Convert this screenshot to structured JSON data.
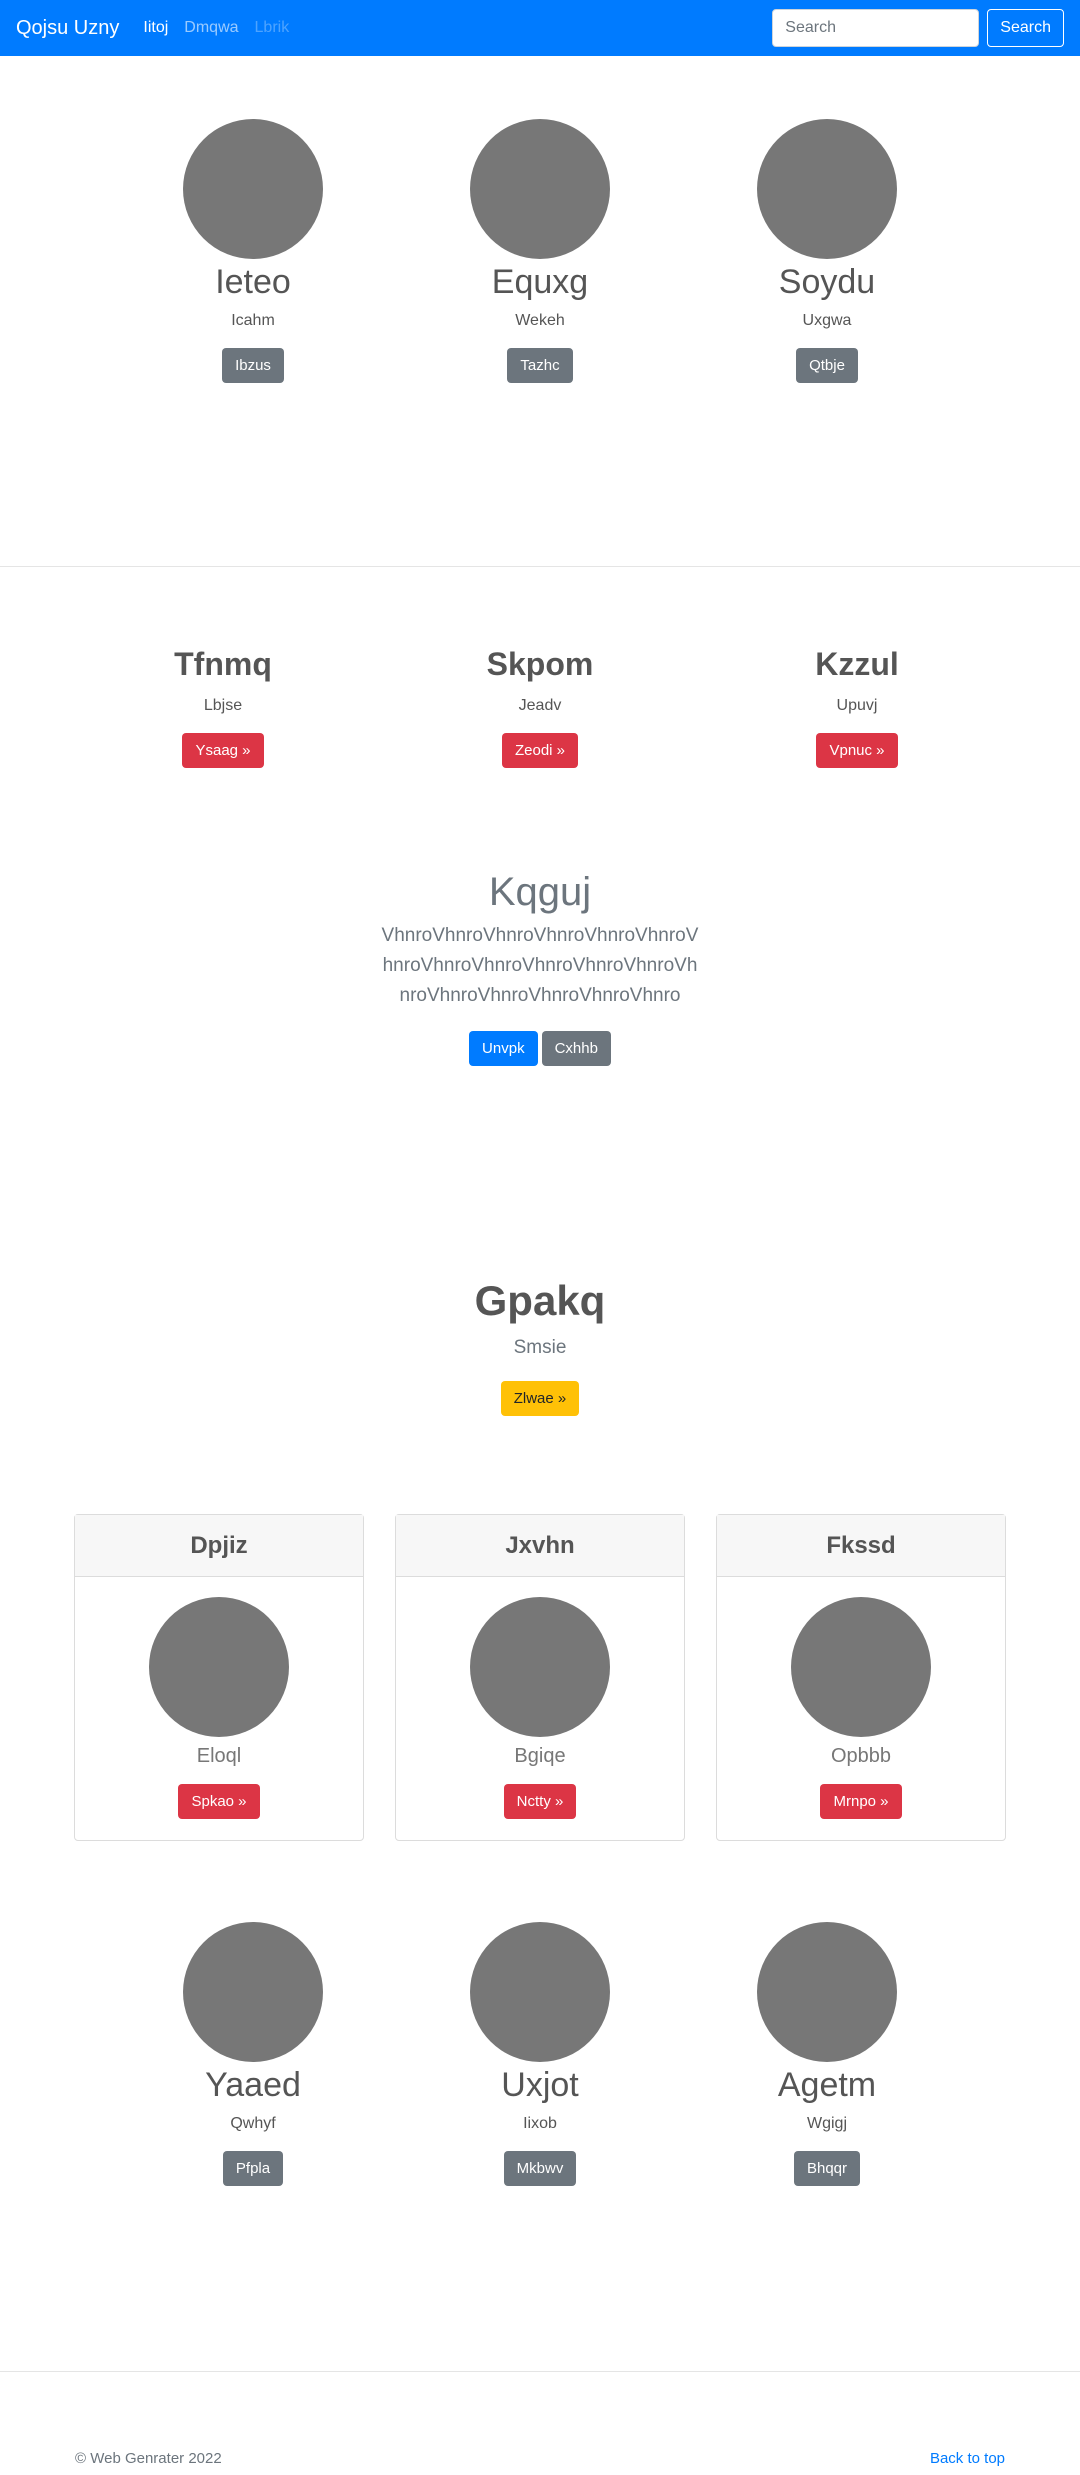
{
  "navbar": {
    "brand": "Qojsu Uzny",
    "links": [
      {
        "label": "Iitoj",
        "state": "active"
      },
      {
        "label": "Dmqwa",
        "state": "normal"
      },
      {
        "label": "Lbrik",
        "state": "disabled"
      }
    ],
    "search_placeholder": "Search",
    "search_button": "Search"
  },
  "profiles_top": [
    {
      "name": "Ieteo",
      "subtitle": "Icahm",
      "button": "Ibzus"
    },
    {
      "name": "Equxg",
      "subtitle": "Wekeh",
      "button": "Tazhc"
    },
    {
      "name": "Soydu",
      "subtitle": "Uxgwa",
      "button": "Qtbje"
    }
  ],
  "features": [
    {
      "title": "Tfnmq",
      "subtitle": "Lbjse",
      "button": "Ysaag »"
    },
    {
      "title": "Skpom",
      "subtitle": "Jeadv",
      "button": "Zeodi »"
    },
    {
      "title": "Kzzul",
      "subtitle": "Upuvj",
      "button": "Vpnuc »"
    }
  ],
  "hero": {
    "title": "Kqguj",
    "lead": "VhnroVhnroVhnroVhnroVhnroVhnroVhnroVhnroVhnroVhnroVhnroVhnroVhnroVhnroVhnroVhnroVhnroVhnro",
    "primary_button": "Unvpk",
    "secondary_button": "Cxhhb"
  },
  "promo": {
    "title": "Gpakq",
    "subtitle": "Smsie",
    "button": "Zlwae »"
  },
  "cards": [
    {
      "header": "Dpjiz",
      "text": "Eloql",
      "button": "Spkao »"
    },
    {
      "header": "Jxvhn",
      "text": "Bgiqe",
      "button": "Nctty »"
    },
    {
      "header": "Fkssd",
      "text": "Opbbb",
      "button": "Mrnpo »"
    }
  ],
  "profiles_bottom": [
    {
      "name": "Yaaed",
      "subtitle": "Qwhyf",
      "button": "Pfpla"
    },
    {
      "name": "Uxjot",
      "subtitle": "Iixob",
      "button": "Mkbwv"
    },
    {
      "name": "Agetm",
      "subtitle": "Wgigj",
      "button": "Bhqqr"
    }
  ],
  "footer": {
    "copyright": "© Web Genrater 2022",
    "back_to_top": "Back to top"
  },
  "colors": {
    "primary": "#007bff",
    "danger": "#dc3545",
    "secondary": "#6c757d",
    "warning": "#ffc107",
    "avatar_gray": "#777777"
  }
}
